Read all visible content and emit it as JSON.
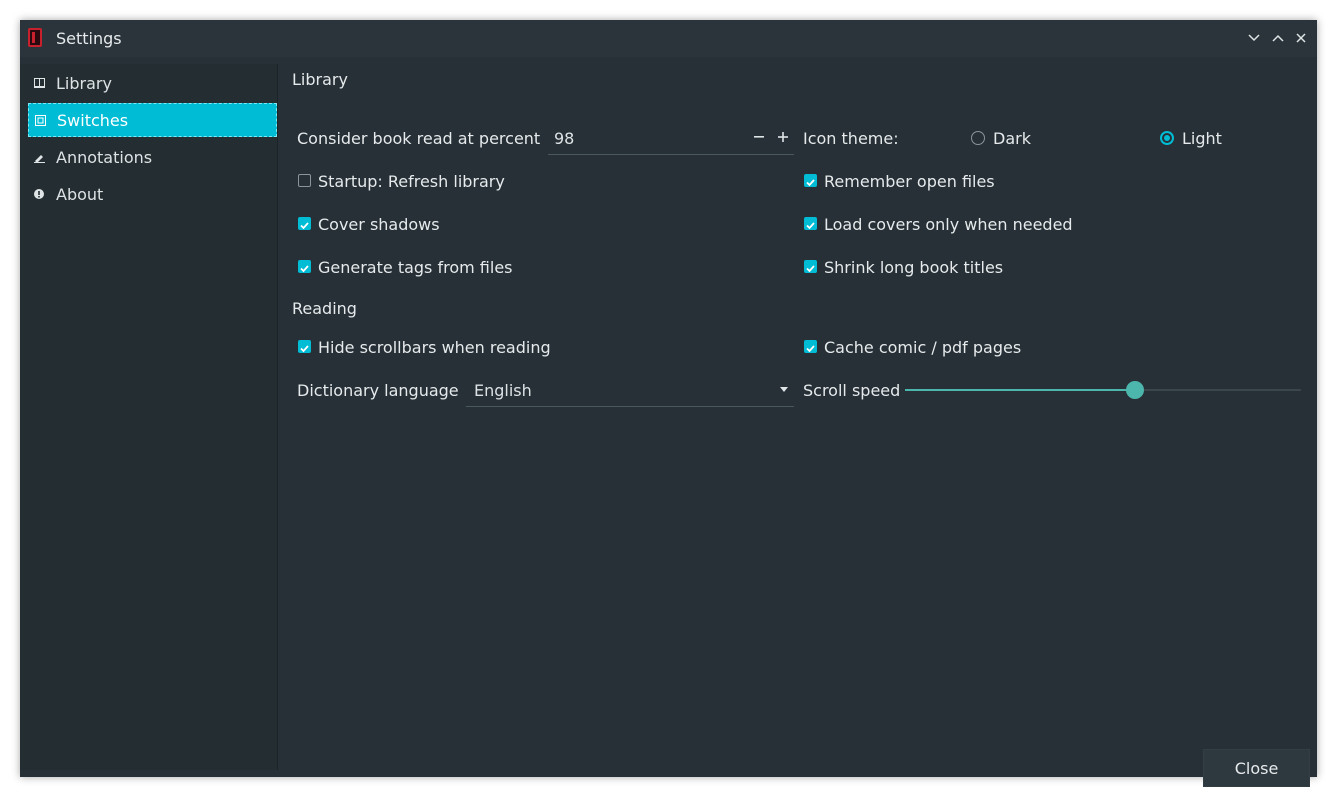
{
  "window": {
    "title": "Settings"
  },
  "sidebar": {
    "items": [
      {
        "label": "Library",
        "icon": "book-icon"
      },
      {
        "label": "Switches",
        "icon": "switches-icon"
      },
      {
        "label": "Annotations",
        "icon": "pen-icon"
      },
      {
        "label": "About",
        "icon": "info-icon"
      }
    ],
    "active_index": 1
  },
  "library": {
    "heading": "Library",
    "read_percent_label": "Consider book read at percent",
    "read_percent_value": "98",
    "icon_theme_label": "Icon theme:",
    "theme_dark": "Dark",
    "theme_light": "Light",
    "theme_selected": "Light",
    "startup_refresh": {
      "label": "Startup: Refresh library",
      "checked": false
    },
    "remember_open": {
      "label": "Remember open files",
      "checked": true
    },
    "cover_shadows": {
      "label": "Cover shadows",
      "checked": true
    },
    "load_covers": {
      "label": "Load covers only when needed",
      "checked": true
    },
    "generate_tags": {
      "label": "Generate tags from files",
      "checked": true
    },
    "shrink_titles": {
      "label": "Shrink long book titles",
      "checked": true
    }
  },
  "reading": {
    "heading": "Reading",
    "hide_scrollbars": {
      "label": "Hide scrollbars when reading",
      "checked": true
    },
    "cache_pages": {
      "label": "Cache comic / pdf pages",
      "checked": true
    },
    "dictionary_label": "Dictionary language",
    "dictionary_value": "English",
    "scroll_speed_label": "Scroll speed",
    "scroll_speed_fraction": 0.58
  },
  "footer": {
    "close_label": "Close"
  },
  "colors": {
    "accent": "#00bcd4",
    "slider": "#4db6ac",
    "background": "#263036"
  }
}
